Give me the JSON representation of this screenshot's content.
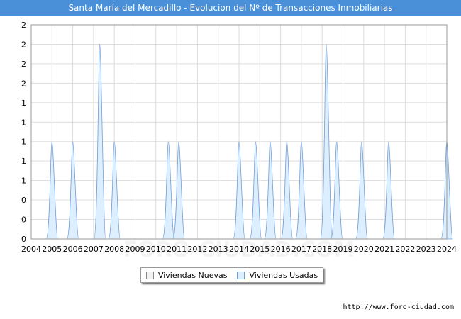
{
  "title": "Santa María del Mercadillo - Evolucion del Nº de Transacciones Inmobiliarias",
  "legend": {
    "nuevas_label": "Viviendas Nuevas",
    "usadas_label": "Viviendas Usadas"
  },
  "source": "http://www.foro-ciudad.com",
  "watermark": "FORO-CIUDAD.COM",
  "colors": {
    "title_bg": "#4a90d9",
    "nuevas_fill": "#f2f2f2",
    "usadas_fill": "#ddeeff",
    "usadas_stroke": "#6f9fd8",
    "grid": "#dddddd"
  },
  "chart_data": {
    "type": "area",
    "x_ticks": [
      "2004",
      "2005",
      "2006",
      "2007",
      "2008",
      "2009",
      "2010",
      "2011",
      "2012",
      "2013",
      "2014",
      "2015",
      "2016",
      "2017",
      "2018",
      "2019",
      "2020",
      "2021",
      "2022",
      "2023",
      "2024"
    ],
    "y_tick_labels": [
      "0",
      "0",
      "0",
      "1",
      "1",
      "1",
      "1",
      "1",
      "2",
      "2",
      "2",
      "2"
    ],
    "ylim": [
      0,
      2.2
    ],
    "grid": true,
    "legend_position": "bottom-center",
    "series": [
      {
        "name": "Viviendas Nuevas",
        "values": []
      },
      {
        "name": "Viviendas Usadas",
        "values": [
          {
            "x": 2005.0,
            "y": 1
          },
          {
            "x": 2006.0,
            "y": 1
          },
          {
            "x": 2007.3,
            "y": 2
          },
          {
            "x": 2008.0,
            "y": 1
          },
          {
            "x": 2010.6,
            "y": 1
          },
          {
            "x": 2011.1,
            "y": 1
          },
          {
            "x": 2014.0,
            "y": 1
          },
          {
            "x": 2014.8,
            "y": 1
          },
          {
            "x": 2015.5,
            "y": 1
          },
          {
            "x": 2016.3,
            "y": 1
          },
          {
            "x": 2017.0,
            "y": 1
          },
          {
            "x": 2018.2,
            "y": 2
          },
          {
            "x": 2018.7,
            "y": 1
          },
          {
            "x": 2019.9,
            "y": 1
          },
          {
            "x": 2021.2,
            "y": 1
          },
          {
            "x": 2024.0,
            "y": 1
          }
        ]
      }
    ]
  }
}
